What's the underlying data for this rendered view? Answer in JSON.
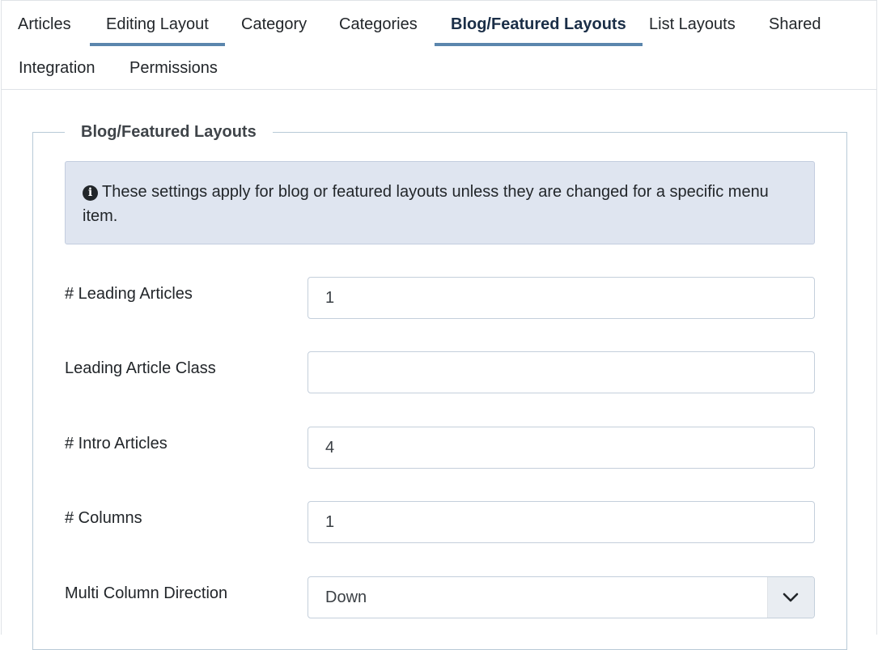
{
  "tabs": [
    {
      "label": "Articles"
    },
    {
      "label": "Editing Layout"
    },
    {
      "label": "Category"
    },
    {
      "label": "Categories"
    },
    {
      "label": "Blog/Featured Layouts"
    },
    {
      "label": "List Layouts"
    },
    {
      "label": "Shared"
    },
    {
      "label": "Integration"
    },
    {
      "label": "Permissions"
    }
  ],
  "section": {
    "legend": "Blog/Featured Layouts",
    "info": "These settings apply for blog or featured layouts unless they are changed for a specific menu item."
  },
  "fields": {
    "leading_articles": {
      "label": "# Leading Articles",
      "value": "1"
    },
    "leading_article_class": {
      "label": "Leading Article Class",
      "value": ""
    },
    "intro_articles": {
      "label": "# Intro Articles",
      "value": "4"
    },
    "columns": {
      "label": "# Columns",
      "value": "1"
    },
    "multi_column_direction": {
      "label": "Multi Column Direction",
      "value": "Down"
    }
  },
  "colors": {
    "tab_underline": "#5b86ad",
    "alert_bg": "#dfe5f0",
    "fieldset_border": "#b8cad7"
  }
}
